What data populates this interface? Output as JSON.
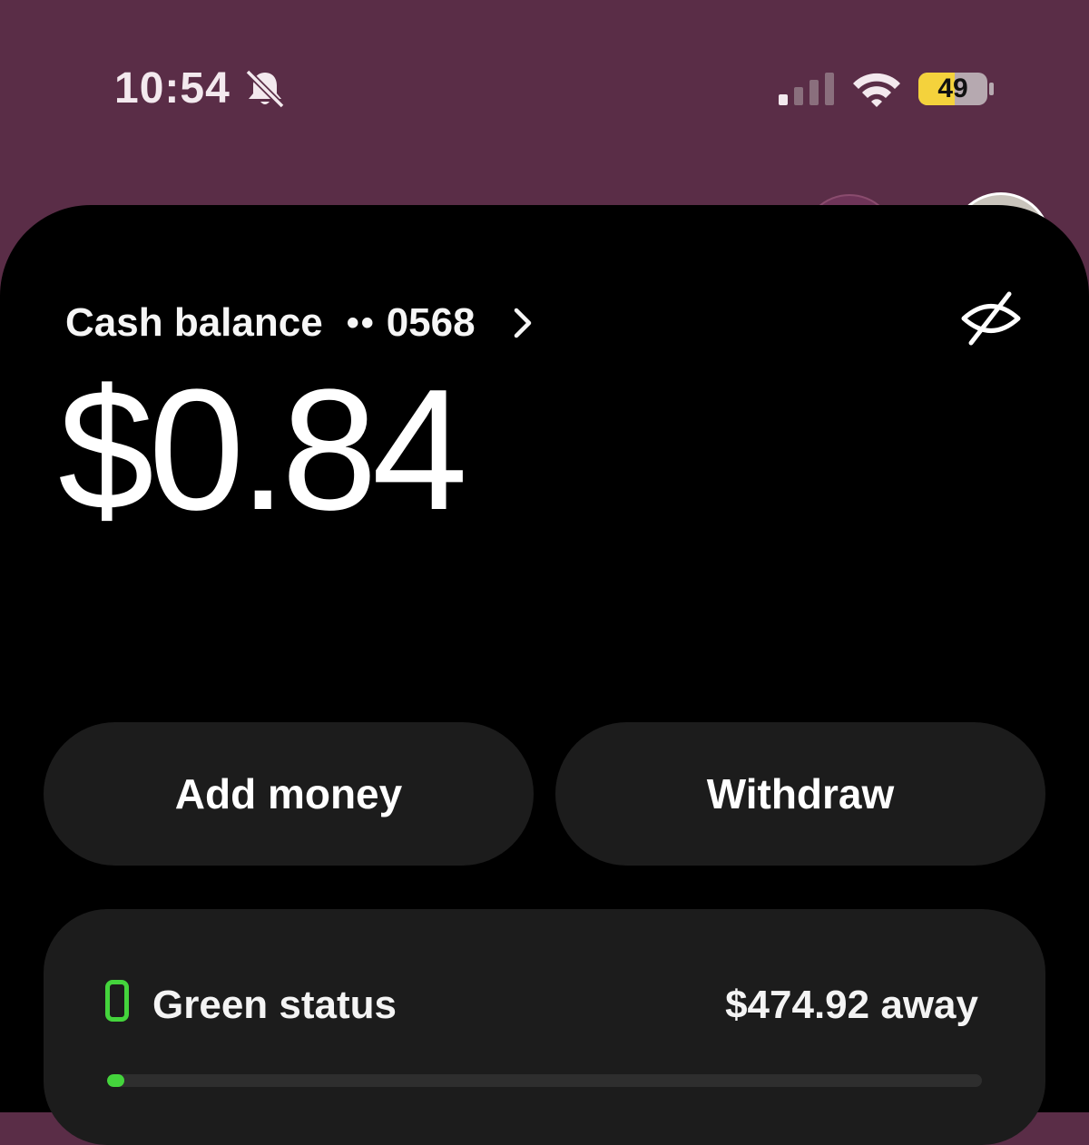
{
  "status_bar": {
    "time": "10:54",
    "battery": "49",
    "icons": [
      "bell-slash-icon",
      "cellular-signal-icon",
      "wifi-icon",
      "battery-icon"
    ]
  },
  "account": {
    "label": "Cash balance",
    "masked_dots": "••",
    "last_digits": "0568",
    "balance": "$0.84"
  },
  "actions": {
    "add_money": "Add money",
    "withdraw": "Withdraw"
  },
  "status": {
    "label": "Green status",
    "away": "$474.92 away",
    "progress_fraction": 0.02
  },
  "colors": {
    "background": "#5a2d47",
    "card": "#000000",
    "button": "#1c1c1c",
    "accent_green": "#44d43c",
    "battery_yellow": "#f4d23c"
  }
}
